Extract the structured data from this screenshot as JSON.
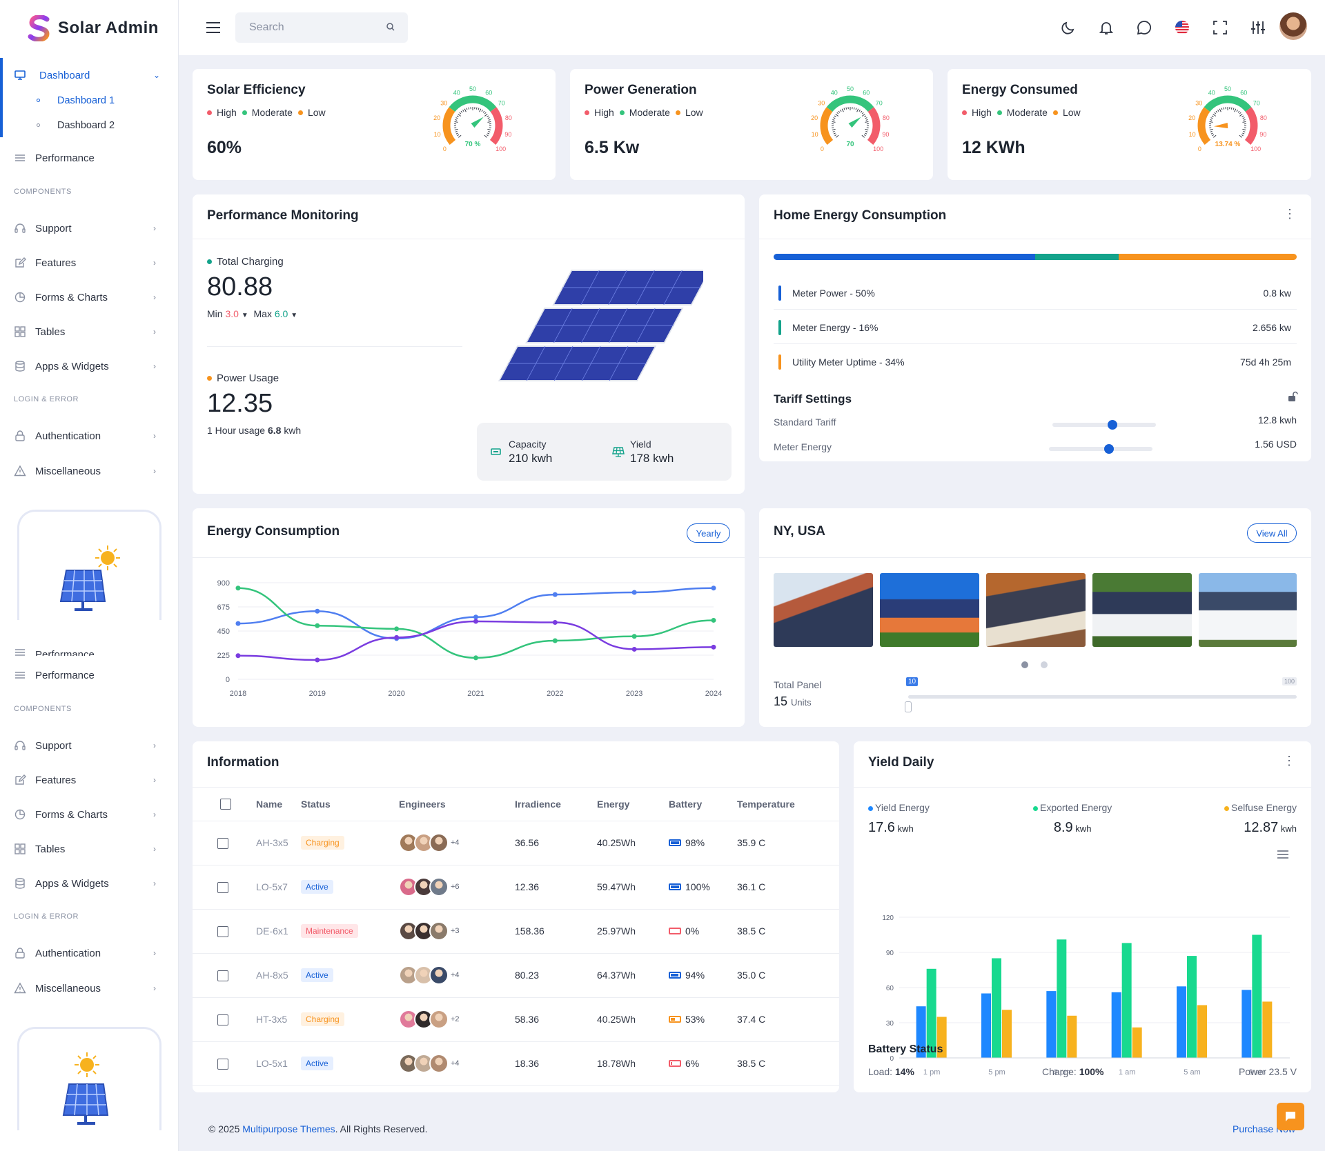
{
  "app": {
    "name": "Solar Admin"
  },
  "topbar": {
    "search_placeholder": "Search"
  },
  "sidebar": {
    "dashboard": "Dashboard",
    "dashboard_1": "Dashboard 1",
    "dashboard_2": "Dashboard 2",
    "performance": "Performance",
    "performance_clipped": "Performance",
    "components_label": "COMPONENTS",
    "login_label": "LOGIN & ERROR",
    "items": [
      "Support",
      "Features",
      "Forms & Charts",
      "Tables",
      "Apps & Widgets"
    ],
    "auth_items": [
      "Authentication",
      "Miscellaneous"
    ]
  },
  "gauge_cards": [
    {
      "title": "Solar Efficiency",
      "value": "60%",
      "gauge_label": "70 %",
      "gauge_label_color": "#34c47c",
      "needle_fraction": 0.7,
      "legend": [
        "High",
        "Moderate",
        "Low"
      ]
    },
    {
      "title": "Power Generation",
      "value": "6.5 Kw",
      "gauge_label": "70",
      "gauge_label_color": "#34c47c",
      "needle_fraction": 0.7,
      "legend": [
        "High",
        "Moderate",
        "Low"
      ]
    },
    {
      "title": "Energy Consumed",
      "value": "12 KWh",
      "gauge_label": "13.74 %",
      "gauge_label_color": "#f7931e",
      "needle_fraction": 0.14,
      "legend": [
        "High",
        "Moderate",
        "Low"
      ]
    }
  ],
  "gauge_ticks": [
    "0",
    "10",
    "20",
    "30",
    "40",
    "50",
    "60",
    "70",
    "80",
    "90",
    "100"
  ],
  "colors": {
    "high": "#f25c6a",
    "moderate": "#34c47c",
    "low": "#f7931e",
    "primary": "#1760d6",
    "teal": "#14a38b"
  },
  "performance": {
    "title": "Performance Monitoring",
    "total_charging_label": "Total Charging",
    "total_charging": "80.88",
    "min_label": "Min",
    "min_value": "3.0",
    "max_label": "Max",
    "max_value": "6.0",
    "power_usage_label": "Power Usage",
    "power_usage": "12.35",
    "hour_usage_prefix": "1 Hour usage",
    "hour_usage_value": "6.8",
    "hour_usage_unit": "kwh",
    "capacity_label": "Capacity",
    "capacity_value": "210 kwh",
    "yield_label": "Yield",
    "yield_value": "178 kwh"
  },
  "home_energy": {
    "title": "Home Energy Consumption",
    "bar_fractions": [
      0.5,
      0.16,
      0.34
    ],
    "rows": [
      {
        "label": "Meter Power - 50%",
        "value": "0.8 kw",
        "color": "#1760d6"
      },
      {
        "label": "Meter Energy - 16%",
        "value": "2.656 kw",
        "color": "#14a38b"
      },
      {
        "label": "Utility Meter Uptime - 34%",
        "value": "75d 4h 25m",
        "color": "#f7931e"
      }
    ],
    "tariff_title": "Tariff Settings",
    "tariff_rows": [
      {
        "label": "Standard Tariff",
        "value": "12.8 kwh",
        "level": 0.58
      },
      {
        "label": "Meter Energy",
        "value": "1.56 USD",
        "level": 0.58
      }
    ]
  },
  "energy_chart": {
    "title": "Energy Consumption",
    "button": "Yearly"
  },
  "chart_data": [
    {
      "type": "line",
      "x": [
        "2018",
        "2019",
        "2020",
        "2021",
        "2022",
        "2023",
        "2024"
      ],
      "yticks": [
        "0",
        "225",
        "450",
        "675",
        "900"
      ],
      "ylim": [
        0,
        900
      ],
      "series": [
        {
          "values": [
            520,
            635,
            380,
            580,
            790,
            810,
            850
          ],
          "color": "#4f7ef0"
        },
        {
          "values": [
            850,
            500,
            470,
            200,
            360,
            400,
            550
          ],
          "color": "#34c47c"
        },
        {
          "values": [
            220,
            180,
            390,
            540,
            530,
            280,
            300
          ],
          "color": "#7a3ce0"
        }
      ]
    },
    {
      "type": "bar",
      "categories": [
        "1 pm",
        "5 pm",
        "9 pm",
        "1 am",
        "5 am",
        "9 am"
      ],
      "yticks": [
        "0",
        "30",
        "60",
        "90",
        "120"
      ],
      "ylim": [
        0,
        120
      ],
      "series": [
        {
          "name": "Yield Energy",
          "values": [
            44,
            55,
            57,
            56,
            61,
            58
          ],
          "color": "#1e88ff"
        },
        {
          "name": "Exported Energy",
          "values": [
            76,
            85,
            101,
            98,
            87,
            105
          ],
          "color": "#18d98f"
        },
        {
          "name": "Selfuse Energy",
          "values": [
            35,
            41,
            36,
            26,
            45,
            48
          ],
          "color": "#f7b21e"
        }
      ]
    }
  ],
  "ny": {
    "title": "NY, USA",
    "button": "View All",
    "total_panel_label": "Total Panel",
    "total_panel_value": "15",
    "total_panel_unit": "Units",
    "slider_min_tag": "10",
    "slider_max_tag": "100",
    "slider_level": 0
  },
  "information": {
    "title": "Information",
    "headers": [
      "Name",
      "Status",
      "Engineers",
      "Irradience",
      "Energy",
      "Battery",
      "Temperature"
    ],
    "rows": [
      {
        "name": "AH-3x5",
        "status": "Charging",
        "more": "+4",
        "irradience": "36.56",
        "energy": "40.25Wh",
        "battery": "98%",
        "battery_level": 0.98,
        "temp": "35.9 C"
      },
      {
        "name": "LO-5x7",
        "status": "Active",
        "more": "+6",
        "irradience": "12.36",
        "energy": "59.47Wh",
        "battery": "100%",
        "battery_level": 1.0,
        "temp": "36.1 C"
      },
      {
        "name": "DE-6x1",
        "status": "Maintenance",
        "more": "+3",
        "irradience": "158.36",
        "energy": "25.97Wh",
        "battery": "0%",
        "battery_level": 0,
        "temp": "38.5 C"
      },
      {
        "name": "AH-8x5",
        "status": "Active",
        "more": "+4",
        "irradience": "80.23",
        "energy": "64.37Wh",
        "battery": "94%",
        "battery_level": 0.94,
        "temp": "35.0 C"
      },
      {
        "name": "HT-3x5",
        "status": "Charging",
        "more": "+2",
        "irradience": "58.36",
        "energy": "40.25Wh",
        "battery": "53%",
        "battery_level": 0.53,
        "temp": "37.4 C"
      },
      {
        "name": "LO-5x1",
        "status": "Active",
        "more": "+4",
        "irradience": "18.36",
        "energy": "18.78Wh",
        "battery": "6%",
        "battery_level": 0.06,
        "temp": "38.5 C"
      }
    ]
  },
  "yield_daily": {
    "title": "Yield Daily",
    "stats": [
      {
        "label": "Yield Energy",
        "value": "17.6",
        "unit": "kwh",
        "color": "#1e88ff"
      },
      {
        "label": "Exported Energy",
        "value": "8.9",
        "unit": "kwh",
        "color": "#18d98f"
      },
      {
        "label": "Selfuse Energy",
        "value": "12.87",
        "unit": "kwh",
        "color": "#f7b21e"
      }
    ],
    "battery_title": "Battery Status",
    "load_label": "Load:",
    "load_value": "14%",
    "charge_label": "Charge:",
    "charge_value": "100%",
    "power_label": "Power 23.5 V"
  },
  "footer": {
    "prefix": "© 2025",
    "company": "Multipurpose Themes",
    "suffix": ". All Rights Reserved.",
    "link": "Purchase Now"
  }
}
